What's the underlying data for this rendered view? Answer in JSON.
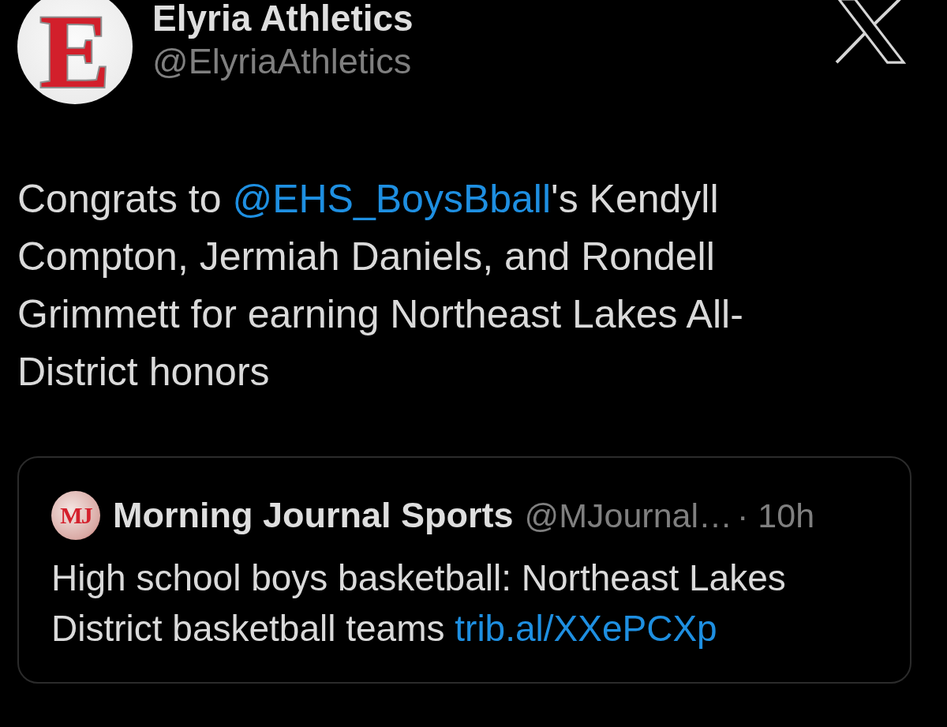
{
  "tweet": {
    "author": {
      "avatar_letter": "E",
      "name": "Elyria Athletics",
      "handle": "@ElyriaAthletics"
    },
    "text": [
      {
        "kind": "text",
        "value": "Congrats to "
      },
      {
        "kind": "mention",
        "value": "@EHS_BoysBball"
      },
      {
        "kind": "text",
        "value": "'s Kendyll Compton, Jermiah Daniels, and Rondell Grimmett for earning Northeast Lakes All-District honors"
      }
    ],
    "quoted": {
      "avatar_letters": "MJ",
      "name": "Morning Journal Sports",
      "handle": "@MJournal…",
      "time": "· 10h",
      "text": [
        {
          "kind": "text",
          "value": "High school boys basketball: Northeast Lakes District basketball teams "
        },
        {
          "kind": "link",
          "value": "trib.al/XXePCXp"
        }
      ]
    }
  }
}
